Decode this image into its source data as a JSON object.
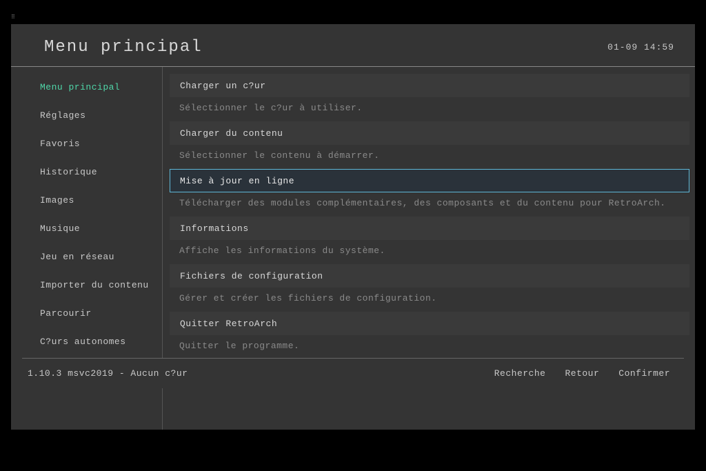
{
  "header": {
    "title": "Menu principal",
    "clock": "01-09 14:59"
  },
  "sidebar": {
    "items": [
      {
        "label": "Menu principal",
        "active": true
      },
      {
        "label": "Réglages",
        "active": false
      },
      {
        "label": "Favoris",
        "active": false
      },
      {
        "label": "Historique",
        "active": false
      },
      {
        "label": "Images",
        "active": false
      },
      {
        "label": "Musique",
        "active": false
      },
      {
        "label": "Jeu en réseau",
        "active": false
      },
      {
        "label": "Importer du contenu",
        "active": false
      },
      {
        "label": "Parcourir",
        "active": false
      },
      {
        "label": "C?urs autonomes",
        "active": false
      }
    ]
  },
  "main": {
    "entries": [
      {
        "label": "Charger un c?ur",
        "desc": "Sélectionner le c?ur à utiliser.",
        "selected": false
      },
      {
        "label": "Charger du contenu",
        "desc": "Sélectionner le contenu à démarrer.",
        "selected": false
      },
      {
        "label": "Mise à jour en ligne",
        "desc": "Télécharger des modules complémentaires, des composants et du contenu pour RetroArch.",
        "selected": true
      },
      {
        "label": "Informations",
        "desc": "Affiche les informations du système.",
        "selected": false
      },
      {
        "label": "Fichiers de configuration",
        "desc": "Gérer et créer les fichiers de configuration.",
        "selected": false
      },
      {
        "label": "Quitter RetroArch",
        "desc": "Quitter le programme.",
        "selected": false
      }
    ]
  },
  "footer": {
    "status": "1.10.3 msvc2019 - Aucun c?ur",
    "actions": [
      {
        "label": "Recherche"
      },
      {
        "label": "Retour"
      },
      {
        "label": "Confirmer"
      }
    ]
  }
}
